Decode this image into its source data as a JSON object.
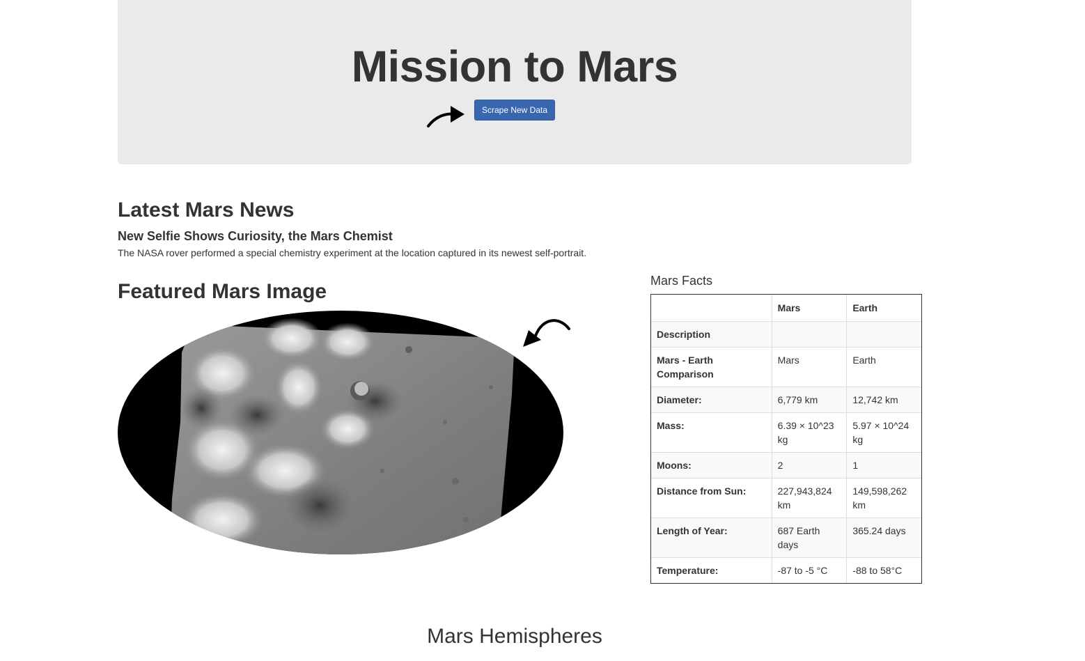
{
  "header": {
    "title": "Mission to Mars",
    "scrape_button_label": "Scrape New Data"
  },
  "news": {
    "heading": "Latest Mars News",
    "title": "New Selfie Shows Curiosity, the Mars Chemist",
    "teaser": "The NASA rover performed a special chemistry experiment at the location captured in its newest self-portrait."
  },
  "featured": {
    "heading": "Featured Mars Image"
  },
  "facts": {
    "heading": "Mars Facts",
    "columns": [
      "",
      "Mars",
      "Earth"
    ],
    "rows": [
      {
        "label": "Description",
        "mars": "",
        "earth": ""
      },
      {
        "label": "Mars - Earth Comparison",
        "mars": "Mars",
        "earth": "Earth"
      },
      {
        "label": "Diameter:",
        "mars": "6,779 km",
        "earth": "12,742 km"
      },
      {
        "label": "Mass:",
        "mars": "6.39 × 10^23 kg",
        "earth": "5.97 × 10^24 kg"
      },
      {
        "label": "Moons:",
        "mars": "2",
        "earth": "1"
      },
      {
        "label": "Distance from Sun:",
        "mars": "227,943,824 km",
        "earth": "149,598,262 km"
      },
      {
        "label": "Length of Year:",
        "mars": "687 Earth days",
        "earth": "365.24 days"
      },
      {
        "label": "Temperature:",
        "mars": "-87 to -5 °C",
        "earth": "-88 to 58°C"
      }
    ]
  },
  "hemispheres": {
    "heading": "Mars Hemispheres"
  },
  "colors": {
    "jumbotron_bg": "#eaeaea",
    "button_bg": "#3867b0",
    "text": "#333333"
  }
}
